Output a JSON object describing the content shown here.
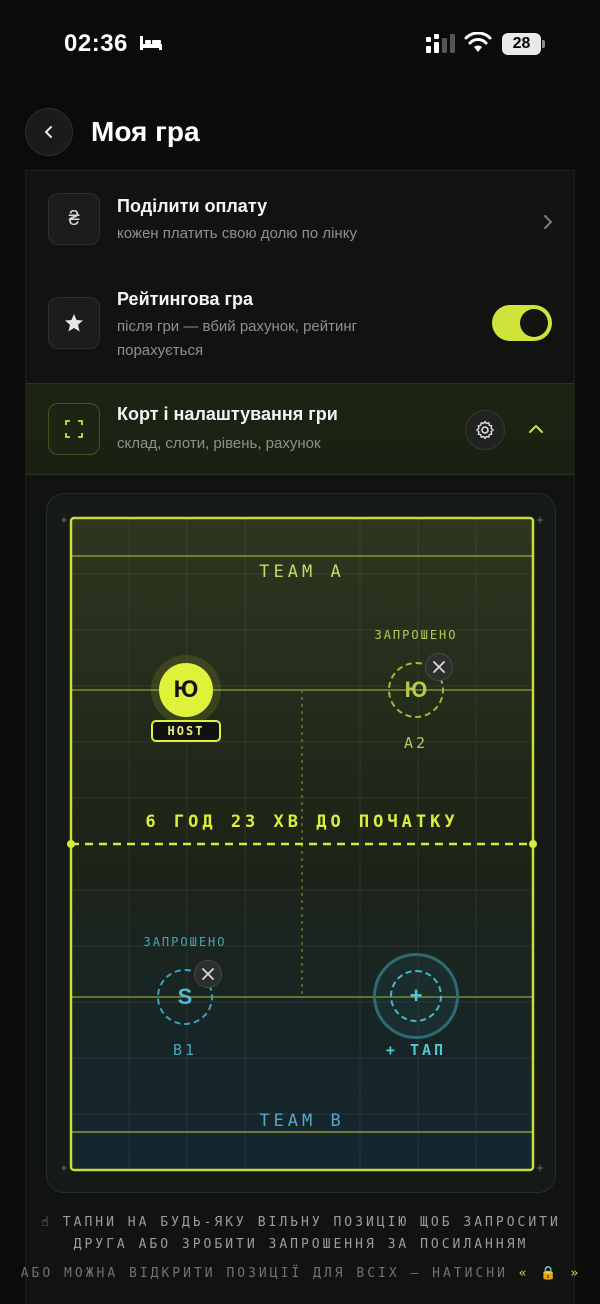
{
  "status_bar": {
    "time": "02:36",
    "battery": "28"
  },
  "header": {
    "title": "Моя гра"
  },
  "rows": {
    "split": {
      "icon_symbol": "₴",
      "title": "Поділити оплату",
      "subtitle": "кожен платить свою долю по лінку"
    },
    "rated": {
      "title": "Рейтингова гра",
      "subtitle": "після гри — вбий рахунок, рейтинг порахується",
      "toggle_on": true
    },
    "court": {
      "title": "Корт і налаштування гри",
      "subtitle": "склад, слоти, рівень, рахунок"
    }
  },
  "court": {
    "team_a": "TEAM A",
    "team_b": "TEAM B",
    "countdown": "6 ГОД 23 ХВ ДО ПОЧАТКУ",
    "host": {
      "initial": "Ю",
      "badge": "HOST"
    },
    "a2": {
      "status": "ЗАПРОШЕНО",
      "initial": "Ю",
      "name": "A2"
    },
    "b1": {
      "status": "ЗАПРОШЕНО",
      "initial": "S",
      "name": "B1"
    },
    "b2": {
      "symbol": "+",
      "label": "+ ТАП"
    }
  },
  "hints": {
    "line1": "☝ ТАПНИ НА БУДЬ-ЯКУ ВІЛЬНУ ПОЗИЦІЮ ЩОБ ЗАПРОСИТИ",
    "line2": "ДРУГА АБО ЗРОБИТИ ЗАПРОШЕННЯ ЗА ПОСИЛАННЯМ",
    "line3": "АБО МОЖНА ВІДКРИТИ ПОЗИЦІЇ ДЛЯ ВСІХ — НАТИСНИ",
    "line3_accent": "« 🔒 »"
  },
  "colors": {
    "accent": "#dff23a",
    "team_a": "#c7d86a",
    "team_b": "#55a8c4"
  }
}
